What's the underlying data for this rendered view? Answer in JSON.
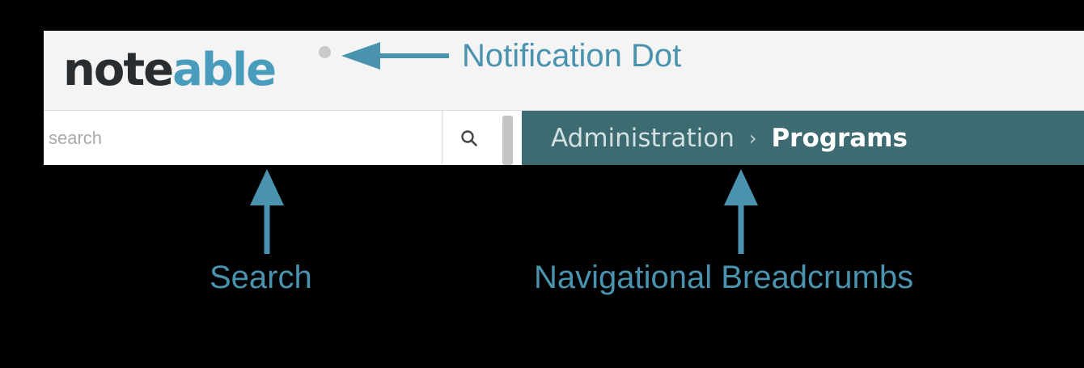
{
  "logo": {
    "part_dark_1": "note",
    "part_teal": "able",
    "part_dark_2": ""
  },
  "search": {
    "placeholder": "search"
  },
  "breadcrumb": {
    "items": [
      "Administration",
      "Programs"
    ],
    "separator": "›"
  },
  "annotations": {
    "notification_dot": "Notification Dot",
    "search": "Search",
    "breadcrumbs": "Navigational Breadcrumbs"
  },
  "icons": {
    "search_button": "search-icon"
  },
  "colors": {
    "brand_dark": "#2a2d2f",
    "brand_teal": "#4a9cbc",
    "breadcrumb_bg": "#3d6b72",
    "annotation": "#4a93ae"
  }
}
